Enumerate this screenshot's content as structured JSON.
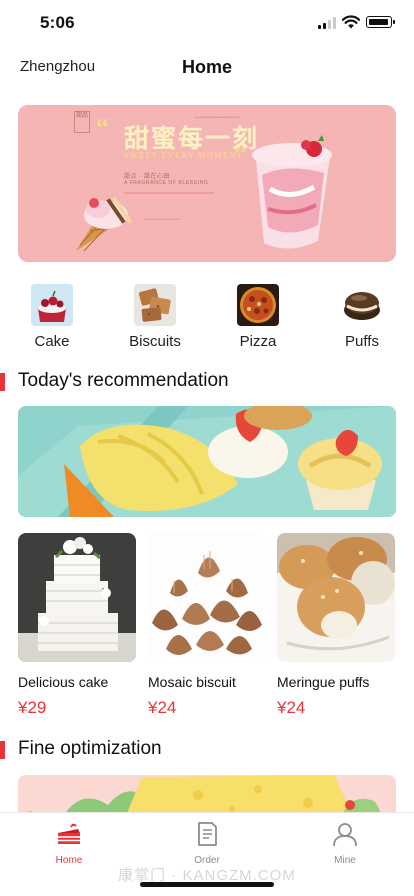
{
  "status": {
    "time": "5:06"
  },
  "nav": {
    "city": "Zhengzhou",
    "title": "Home"
  },
  "banner": {
    "cn_title": "甜蜜每一刻",
    "en_title": "SWEET EVERY MOMENT",
    "stamp": "甜品",
    "small_line": "甜点 · 甜在心田",
    "small_line2": "A FRAGRANCE OF BLESSING",
    "accent": "#f5b5b5"
  },
  "categories": [
    {
      "label": "Cake",
      "icon": "cake-icon"
    },
    {
      "label": "Biscuits",
      "icon": "biscuits-icon"
    },
    {
      "label": "Pizza",
      "icon": "pizza-icon"
    },
    {
      "label": "Puffs",
      "icon": "puffs-icon"
    }
  ],
  "sections": {
    "recommendation": "Today's recommendation",
    "fine": "Fine optimization"
  },
  "products": [
    {
      "name": "Delicious cake",
      "price": "¥29"
    },
    {
      "name": "Mosaic biscuit",
      "price": "¥24"
    },
    {
      "name": "Meringue puffs",
      "price": "¥24"
    }
  ],
  "tabs": [
    {
      "label": "Home",
      "icon": "home-cake-icon",
      "active": true
    },
    {
      "label": "Order",
      "icon": "order-document-icon",
      "active": false
    },
    {
      "label": "Mine",
      "icon": "person-icon",
      "active": false
    }
  ],
  "watermark": "康掌门 · KANGZM.COM",
  "colors": {
    "accent_red": "#e8333a",
    "tab_inactive": "#8c8c8c"
  }
}
